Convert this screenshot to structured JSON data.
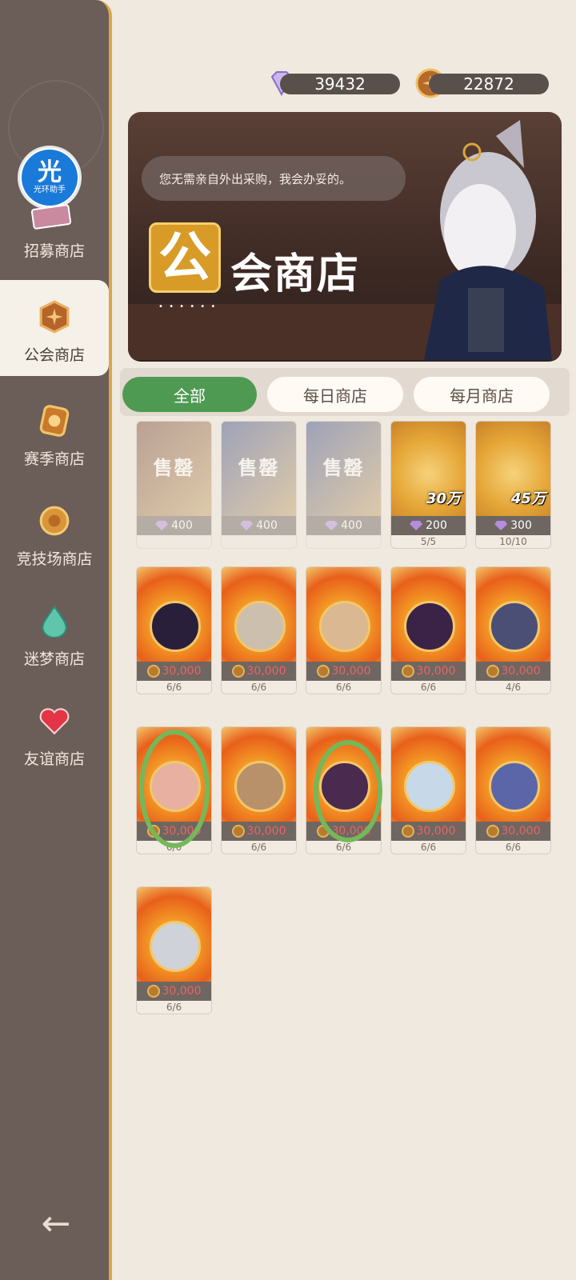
{
  "currency": {
    "diamonds": "39432",
    "guild_coins": "22872"
  },
  "sidebar": {
    "helper_badge": {
      "big": "光",
      "small": "光环助手"
    },
    "items": [
      {
        "label": "招募商店",
        "icon": "recruit-icon",
        "active": false
      },
      {
        "label": "公会商店",
        "icon": "guild-coin-icon",
        "active": true
      },
      {
        "label": "赛季商店",
        "icon": "season-icon",
        "active": false
      },
      {
        "label": "竞技场商店",
        "icon": "arena-coin-icon",
        "active": false
      },
      {
        "label": "迷梦商店",
        "icon": "dream-drop-icon",
        "active": false
      },
      {
        "label": "友谊商店",
        "icon": "heart-icon",
        "active": false
      }
    ],
    "back_icon": "back-arrow-icon"
  },
  "banner": {
    "speech": "您无需亲自外出采购，我会办妥的。",
    "title_char": "公",
    "title_rest": "会商店",
    "dots": "• • • • • •"
  },
  "tabs": [
    {
      "label": "全部",
      "active": true
    },
    {
      "label": "每日商店",
      "active": false
    },
    {
      "label": "每月商店",
      "active": false
    }
  ],
  "items_row1": [
    {
      "soldout_text": "售罄",
      "price": "400",
      "currency": "diamond"
    },
    {
      "soldout_text": "售罄",
      "price": "400",
      "currency": "diamond"
    },
    {
      "soldout_text": "售罄",
      "price": "400",
      "currency": "diamond"
    },
    {
      "amount": "30万",
      "price": "200",
      "currency": "diamond",
      "limit": "5/5"
    },
    {
      "amount": "45万",
      "price": "300",
      "currency": "diamond",
      "limit": "10/10"
    }
  ],
  "items_row2": [
    {
      "price": "30,000",
      "limit": "6/6"
    },
    {
      "price": "30,000",
      "limit": "6/6"
    },
    {
      "price": "30,000",
      "limit": "6/6"
    },
    {
      "price": "30,000",
      "limit": "6/6"
    },
    {
      "price": "30,000",
      "limit": "4/6"
    }
  ],
  "items_row3": [
    {
      "price": "30,000",
      "limit": "6/6"
    },
    {
      "price": "30,000",
      "limit": "6/6"
    },
    {
      "price": "30,000",
      "limit": "6/6"
    },
    {
      "price": "30,000",
      "limit": "6/6"
    },
    {
      "price": "30,000",
      "limit": "6/6"
    }
  ],
  "items_row4": [
    {
      "price": "30,000",
      "limit": "6/6"
    }
  ],
  "colors": {
    "accent_green": "#4f9a52",
    "price_red": "#e86466",
    "sidebar_bg": "#6b5d57",
    "highlight_ring": "#74b85a"
  }
}
